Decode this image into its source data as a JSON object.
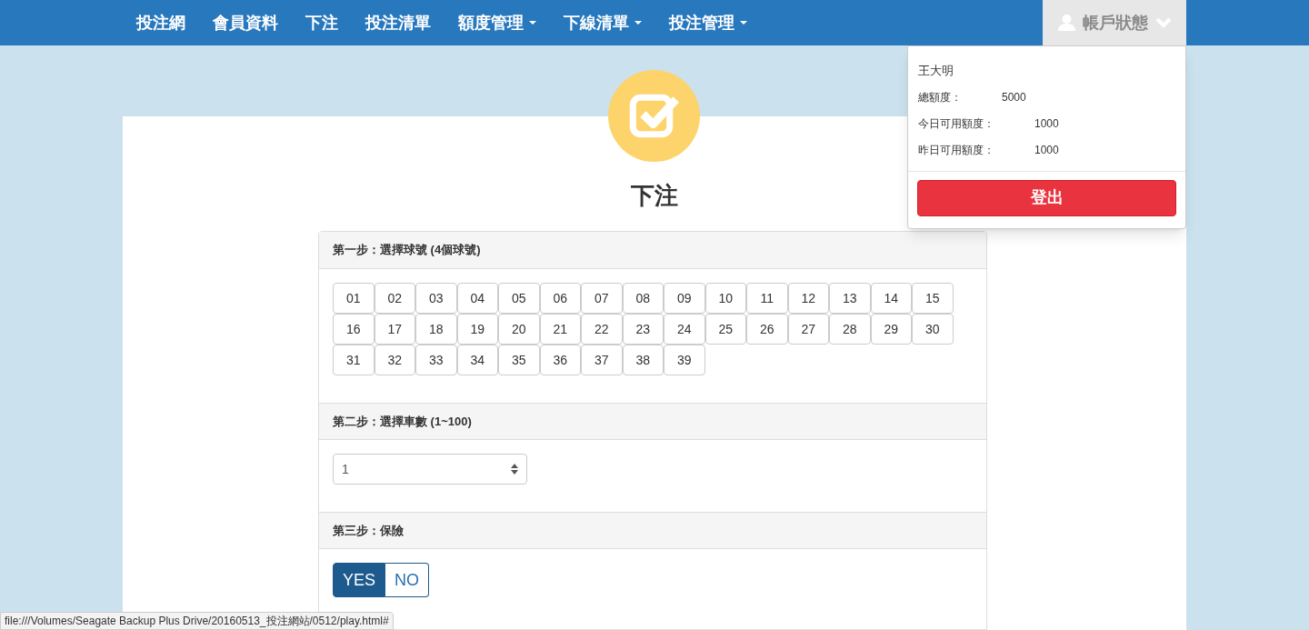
{
  "navbar": {
    "items": [
      {
        "label": "投注網",
        "caret": false
      },
      {
        "label": "會員資料",
        "caret": false
      },
      {
        "label": "下注",
        "caret": false
      },
      {
        "label": "投注清單",
        "caret": false
      },
      {
        "label": "額度管理",
        "caret": true
      },
      {
        "label": "下線清單",
        "caret": true
      },
      {
        "label": "投注管理",
        "caret": true
      }
    ],
    "account": {
      "label": "帳戶狀態",
      "expanded": true
    }
  },
  "account_menu": {
    "name": "王大明",
    "rows": [
      {
        "label": "總額度：",
        "value": "5000"
      },
      {
        "label": "今日可用額度：",
        "value": "1000"
      },
      {
        "label": "昨日可用額度：",
        "value": "1000"
      }
    ],
    "logout": "登出"
  },
  "page": {
    "title": "下注"
  },
  "step1": {
    "title": "第一步：選擇球號 (4個球號)",
    "numbers": [
      {
        "label": "01",
        "selected": false
      },
      {
        "label": "02",
        "selected": false
      },
      {
        "label": "03",
        "selected": false
      },
      {
        "label": "04",
        "selected": false
      },
      {
        "label": "05",
        "selected": false
      },
      {
        "label": "06",
        "selected": false
      },
      {
        "label": "07",
        "selected": false
      },
      {
        "label": "08",
        "selected": false
      },
      {
        "label": "09",
        "selected": false
      },
      {
        "label": "10",
        "selected": false
      },
      {
        "label": "11",
        "selected": false
      },
      {
        "label": "12",
        "selected": false
      },
      {
        "label": "13",
        "selected": false
      },
      {
        "label": "14",
        "selected": false
      },
      {
        "label": "15",
        "selected": false
      },
      {
        "label": "16",
        "selected": false
      },
      {
        "label": "17",
        "selected": false
      },
      {
        "label": "18",
        "selected": false
      },
      {
        "label": "19",
        "selected": false
      },
      {
        "label": "20",
        "selected": false
      },
      {
        "label": "21",
        "selected": false
      },
      {
        "label": "22",
        "selected": false
      },
      {
        "label": "23",
        "selected": false
      },
      {
        "label": "24",
        "selected": false
      },
      {
        "label": "25",
        "selected": false
      },
      {
        "label": "26",
        "selected": false
      },
      {
        "label": "27",
        "selected": false
      },
      {
        "label": "28",
        "selected": false
      },
      {
        "label": "29",
        "selected": false
      },
      {
        "label": "30",
        "selected": false
      },
      {
        "label": "31",
        "selected": false
      },
      {
        "label": "32",
        "selected": false
      },
      {
        "label": "33",
        "selected": false
      },
      {
        "label": "34",
        "selected": false
      },
      {
        "label": "35",
        "selected": false
      },
      {
        "label": "36",
        "selected": false
      },
      {
        "label": "37",
        "selected": false
      },
      {
        "label": "38",
        "selected": false
      },
      {
        "label": "39",
        "selected": false
      }
    ]
  },
  "step2": {
    "title": "第二步：選擇車數 (1~100)",
    "value": "1"
  },
  "step3": {
    "title": "第三步：保險",
    "options": [
      {
        "label": "YES",
        "selected": true
      },
      {
        "label": "NO",
        "selected": false
      }
    ]
  },
  "status_bar": {
    "url": "file:///Volumes/Seagate Backup Plus Drive/20160513_投注網站/0512/play.html#"
  }
}
